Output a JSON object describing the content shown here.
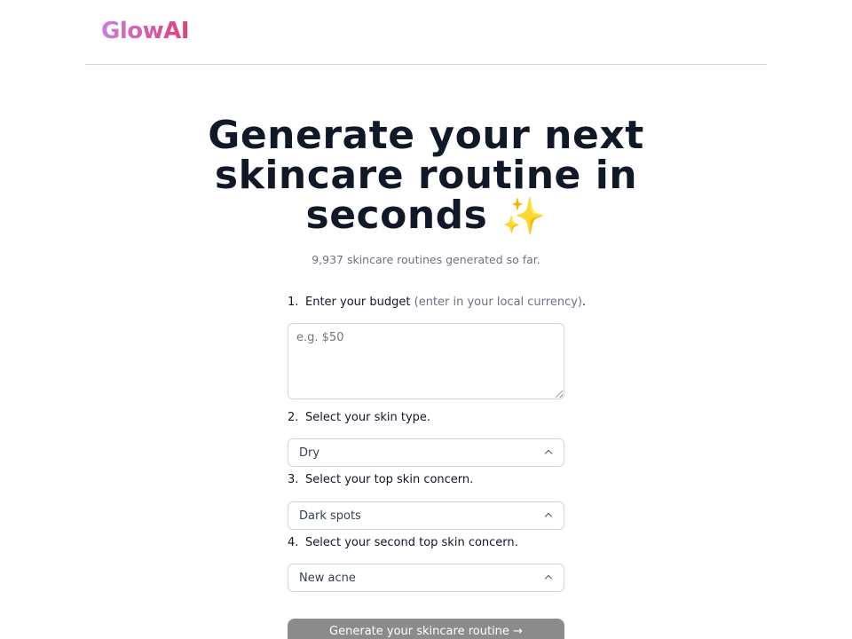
{
  "header": {
    "logo": "GlowAI"
  },
  "hero": {
    "title_line1": "Generate your next",
    "title_line2": "skincare routine in",
    "title_line3": "seconds",
    "sparkle": "✨",
    "counter": "9,937 skincare routines generated so far."
  },
  "form": {
    "step1": {
      "number": "1.",
      "label": "Enter your budget",
      "hint": "(enter in your local currency)",
      "suffix": ".",
      "placeholder": "e.g. $50"
    },
    "step2": {
      "number": "2.",
      "label": "Select your skin type.",
      "value": "Dry"
    },
    "step3": {
      "number": "3.",
      "label": "Select your top skin concern.",
      "value": "Dark spots"
    },
    "step4": {
      "number": "4.",
      "label": "Select your second top skin concern.",
      "value": "New acne"
    },
    "submit_label": "Generate your skincare routine →"
  }
}
